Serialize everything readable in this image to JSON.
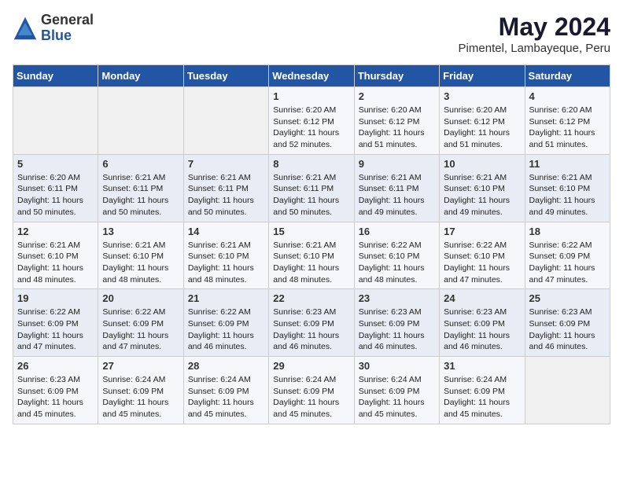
{
  "header": {
    "logo_general": "General",
    "logo_blue": "Blue",
    "title": "May 2024",
    "subtitle": "Pimentel, Lambayeque, Peru"
  },
  "weekdays": [
    "Sunday",
    "Monday",
    "Tuesday",
    "Wednesday",
    "Thursday",
    "Friday",
    "Saturday"
  ],
  "weeks": [
    [
      {
        "day": "",
        "info": ""
      },
      {
        "day": "",
        "info": ""
      },
      {
        "day": "",
        "info": ""
      },
      {
        "day": "1",
        "info": "Sunrise: 6:20 AM\nSunset: 6:12 PM\nDaylight: 11 hours\nand 52 minutes."
      },
      {
        "day": "2",
        "info": "Sunrise: 6:20 AM\nSunset: 6:12 PM\nDaylight: 11 hours\nand 51 minutes."
      },
      {
        "day": "3",
        "info": "Sunrise: 6:20 AM\nSunset: 6:12 PM\nDaylight: 11 hours\nand 51 minutes."
      },
      {
        "day": "4",
        "info": "Sunrise: 6:20 AM\nSunset: 6:12 PM\nDaylight: 11 hours\nand 51 minutes."
      }
    ],
    [
      {
        "day": "5",
        "info": "Sunrise: 6:20 AM\nSunset: 6:11 PM\nDaylight: 11 hours\nand 50 minutes."
      },
      {
        "day": "6",
        "info": "Sunrise: 6:21 AM\nSunset: 6:11 PM\nDaylight: 11 hours\nand 50 minutes."
      },
      {
        "day": "7",
        "info": "Sunrise: 6:21 AM\nSunset: 6:11 PM\nDaylight: 11 hours\nand 50 minutes."
      },
      {
        "day": "8",
        "info": "Sunrise: 6:21 AM\nSunset: 6:11 PM\nDaylight: 11 hours\nand 50 minutes."
      },
      {
        "day": "9",
        "info": "Sunrise: 6:21 AM\nSunset: 6:11 PM\nDaylight: 11 hours\nand 49 minutes."
      },
      {
        "day": "10",
        "info": "Sunrise: 6:21 AM\nSunset: 6:10 PM\nDaylight: 11 hours\nand 49 minutes."
      },
      {
        "day": "11",
        "info": "Sunrise: 6:21 AM\nSunset: 6:10 PM\nDaylight: 11 hours\nand 49 minutes."
      }
    ],
    [
      {
        "day": "12",
        "info": "Sunrise: 6:21 AM\nSunset: 6:10 PM\nDaylight: 11 hours\nand 48 minutes."
      },
      {
        "day": "13",
        "info": "Sunrise: 6:21 AM\nSunset: 6:10 PM\nDaylight: 11 hours\nand 48 minutes."
      },
      {
        "day": "14",
        "info": "Sunrise: 6:21 AM\nSunset: 6:10 PM\nDaylight: 11 hours\nand 48 minutes."
      },
      {
        "day": "15",
        "info": "Sunrise: 6:21 AM\nSunset: 6:10 PM\nDaylight: 11 hours\nand 48 minutes."
      },
      {
        "day": "16",
        "info": "Sunrise: 6:22 AM\nSunset: 6:10 PM\nDaylight: 11 hours\nand 48 minutes."
      },
      {
        "day": "17",
        "info": "Sunrise: 6:22 AM\nSunset: 6:10 PM\nDaylight: 11 hours\nand 47 minutes."
      },
      {
        "day": "18",
        "info": "Sunrise: 6:22 AM\nSunset: 6:09 PM\nDaylight: 11 hours\nand 47 minutes."
      }
    ],
    [
      {
        "day": "19",
        "info": "Sunrise: 6:22 AM\nSunset: 6:09 PM\nDaylight: 11 hours\nand 47 minutes."
      },
      {
        "day": "20",
        "info": "Sunrise: 6:22 AM\nSunset: 6:09 PM\nDaylight: 11 hours\nand 47 minutes."
      },
      {
        "day": "21",
        "info": "Sunrise: 6:22 AM\nSunset: 6:09 PM\nDaylight: 11 hours\nand 46 minutes."
      },
      {
        "day": "22",
        "info": "Sunrise: 6:23 AM\nSunset: 6:09 PM\nDaylight: 11 hours\nand 46 minutes."
      },
      {
        "day": "23",
        "info": "Sunrise: 6:23 AM\nSunset: 6:09 PM\nDaylight: 11 hours\nand 46 minutes."
      },
      {
        "day": "24",
        "info": "Sunrise: 6:23 AM\nSunset: 6:09 PM\nDaylight: 11 hours\nand 46 minutes."
      },
      {
        "day": "25",
        "info": "Sunrise: 6:23 AM\nSunset: 6:09 PM\nDaylight: 11 hours\nand 46 minutes."
      }
    ],
    [
      {
        "day": "26",
        "info": "Sunrise: 6:23 AM\nSunset: 6:09 PM\nDaylight: 11 hours\nand 45 minutes."
      },
      {
        "day": "27",
        "info": "Sunrise: 6:24 AM\nSunset: 6:09 PM\nDaylight: 11 hours\nand 45 minutes."
      },
      {
        "day": "28",
        "info": "Sunrise: 6:24 AM\nSunset: 6:09 PM\nDaylight: 11 hours\nand 45 minutes."
      },
      {
        "day": "29",
        "info": "Sunrise: 6:24 AM\nSunset: 6:09 PM\nDaylight: 11 hours\nand 45 minutes."
      },
      {
        "day": "30",
        "info": "Sunrise: 6:24 AM\nSunset: 6:09 PM\nDaylight: 11 hours\nand 45 minutes."
      },
      {
        "day": "31",
        "info": "Sunrise: 6:24 AM\nSunset: 6:09 PM\nDaylight: 11 hours\nand 45 minutes."
      },
      {
        "day": "",
        "info": ""
      }
    ]
  ]
}
